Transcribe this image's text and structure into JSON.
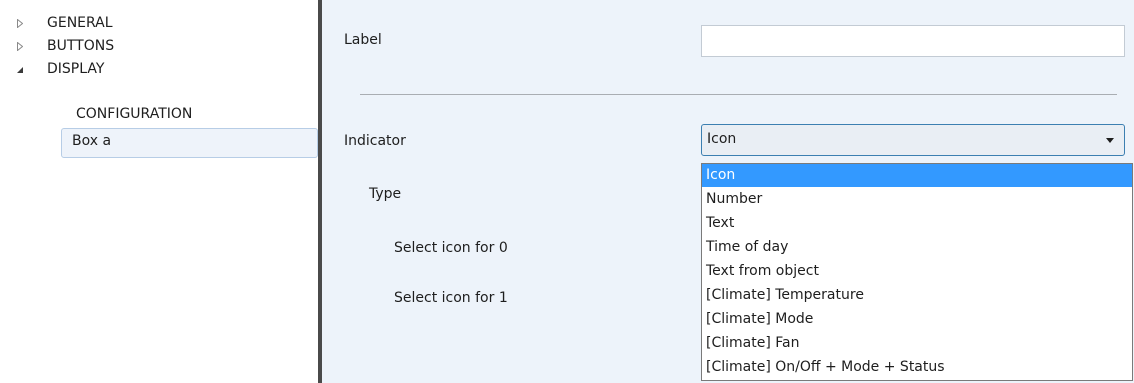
{
  "tree": {
    "items": [
      {
        "label": "GENERAL",
        "arrow": "collapsed"
      },
      {
        "label": "BUTTONS",
        "arrow": "collapsed"
      },
      {
        "label": "DISPLAY",
        "arrow": "expanded"
      },
      {
        "label": "CONFIGURATION"
      },
      {
        "label": "Box a",
        "selected": true
      }
    ]
  },
  "params": {
    "label_label": "Label",
    "label_value": "",
    "indicator_label": "Indicator",
    "indicator_value": "Icon",
    "type_label": "Type",
    "icon0_label": "Select icon for 0",
    "icon1_label": "Select icon for 1"
  },
  "dropdown": {
    "options": [
      "Icon",
      "Number",
      "Text",
      "Time of day",
      "Text from object",
      "[Climate] Temperature",
      "[Climate] Mode",
      "[Climate] Fan",
      "[Climate] On/Off + Mode + Status"
    ],
    "selected_index": 0
  },
  "colors": {
    "panel_bg": "#edf3fa",
    "selection_blue": "#3399ff",
    "splitter": "#4a4a4a"
  }
}
